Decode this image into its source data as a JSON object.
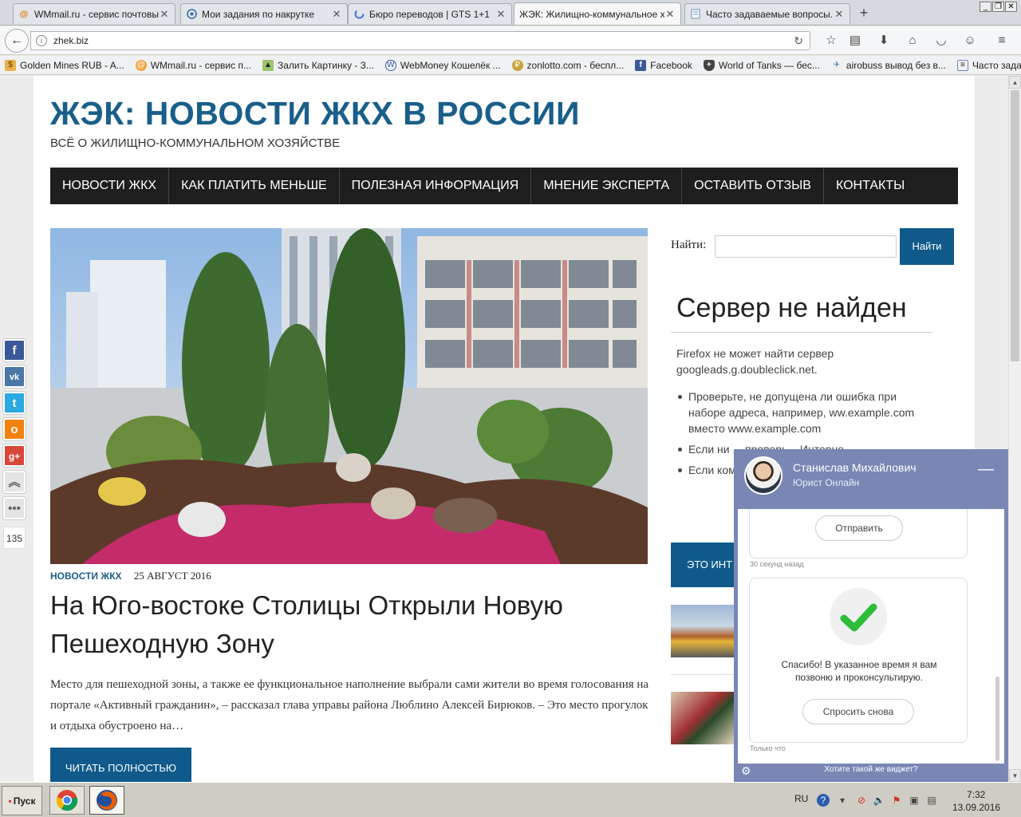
{
  "browser": {
    "tabs": [
      {
        "label": "WMmail.ru - сервис почтовы...",
        "icon": "wmmail-icon"
      },
      {
        "label": "Мои задания по накрутке",
        "icon": "target-icon"
      },
      {
        "label": "Бюро переводов | GTS 1+1",
        "icon": "loading-icon"
      },
      {
        "label": "ЖЭК: Жилищно-коммунальное х...",
        "icon": "none"
      },
      {
        "label": "Часто задаваемые вопросы...",
        "icon": "page-icon"
      }
    ],
    "new_tab": "+",
    "url": "zhek.biz",
    "bookmarks": [
      {
        "label": "Golden Mines RUB - A...",
        "icon": "golden-mines-icon"
      },
      {
        "label": "WMmail.ru - сервис п...",
        "icon": "wmmail-icon"
      },
      {
        "label": "Залить Картинку - З...",
        "icon": "image-icon"
      },
      {
        "label": "WebMoney Кошелёк ...",
        "icon": "webmoney-icon"
      },
      {
        "label": "zonlotto.com - беспл...",
        "icon": "zonlotto-icon"
      },
      {
        "label": "Facebook",
        "icon": "facebook-icon"
      },
      {
        "label": "World of Tanks — бес...",
        "icon": "wot-icon"
      },
      {
        "label": "airobuss вывод без в...",
        "icon": "plane-icon"
      },
      {
        "label": "Часто задаваемые в...",
        "icon": "page-icon"
      }
    ]
  },
  "site": {
    "title": "ЖЭК: НОВОСТИ ЖКХ В РОССИИ",
    "tagline": "ВСЁ О ЖИЛИЩНО-КОММУНАЛЬНОМ ХОЗЯЙСТВЕ",
    "nav": [
      "НОВОСТИ ЖКХ",
      "КАК ПЛАТИТЬ МЕНЬШЕ",
      "ПОЛЕЗНАЯ ИНФОРМАЦИЯ",
      "МНЕНИЕ ЭКСПЕРТА",
      "ОСТАВИТЬ ОТЗЫВ",
      "КОНТАКТЫ"
    ]
  },
  "post": {
    "category": "НОВОСТИ ЖКХ",
    "date": "25 АВГУСТ 2016",
    "title": "На Юго-востоке Столицы Открыли Новую Пешеходную Зону",
    "excerpt": "Место для пешеходной зоны, а также ее функциональное наполнение выбрали сами жители во время голосования на портале «Активный гражданин», – рассказал глава управы района Люблино Алексей Бирюков. – Это место прогулок и отдыха обустроено на…",
    "read_more": "ЧИТАТЬ ПОЛНОСТЬЮ"
  },
  "sidebar": {
    "search_label": "Найти:",
    "search_button": "Найти",
    "error_title": "Сервер не найден",
    "error_text": "Firefox не может найти сервер googleads.g.doubleclick.net.",
    "error_items": [
      "Проверьте, не допущена ли ошибка при наборе адреса, например, ww.example.com вместо www.example.com",
      "Если ни ... проверь... Интерне...",
      "Если ком..."
    ],
    "blue_button": "ЭТО ИНТ"
  },
  "social": {
    "count": "135"
  },
  "chat": {
    "name": "Станислав Михайлович",
    "role": "Юрист Онлайн",
    "send_button": "Отправить",
    "time_ago": "30 секунд назад",
    "thanks": "Спасибо! В указанное время я вам позвоню и проконсультирую.",
    "ask_again": "Спросить снова",
    "just_now": "Только что",
    "footer": "Хотите такой же виджет?"
  },
  "taskbar": {
    "start": "Пуск",
    "lang": "RU",
    "time": "7:32",
    "date": "13.09.2016"
  },
  "colors": {
    "accent": "#0f5a8a",
    "title": "#1a5f8a",
    "nav_bg": "#1e1e1e",
    "chat": "#7a87b5"
  }
}
